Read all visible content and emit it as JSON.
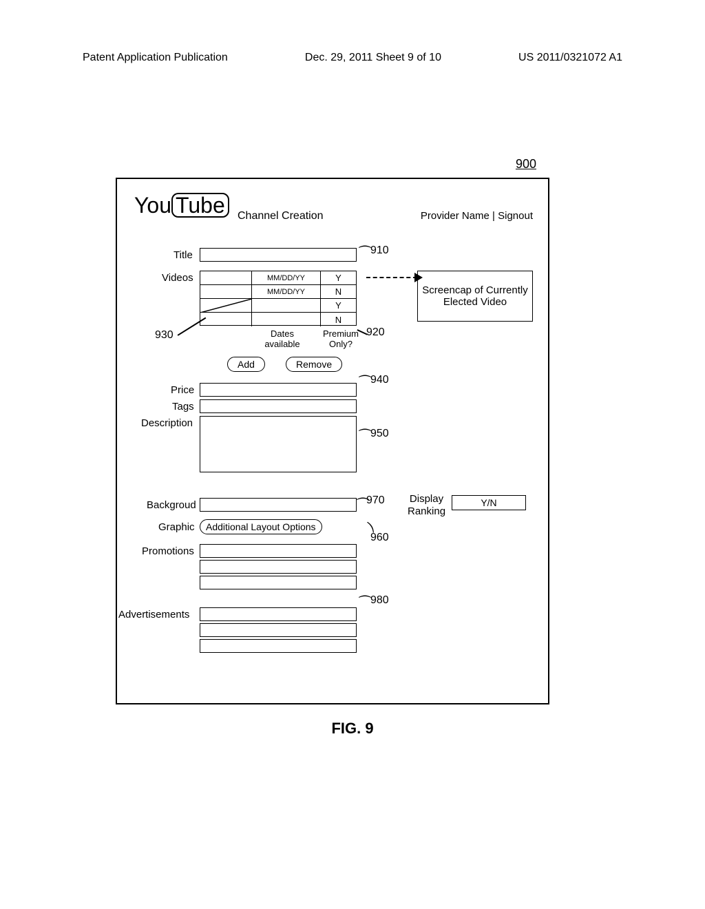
{
  "header": {
    "left": "Patent Application Publication",
    "center": "Dec. 29, 2011  Sheet 9 of 10",
    "right": "US 2011/0321072 A1"
  },
  "figure_ref": "900",
  "figure_caption": "FIG. 9",
  "logo": {
    "you": "You",
    "tube": "Tube"
  },
  "labels": {
    "channel_creation": "Channel Creation",
    "provider_signout": "Provider Name | Signout",
    "title": "Title",
    "videos": "Videos",
    "dates_available": "Dates available",
    "premium_only": "Premium Only?",
    "add": "Add",
    "remove": "Remove",
    "price": "Price",
    "tags": "Tags",
    "description": "Description",
    "background": "Backgroud",
    "graphic": "Graphic",
    "additional_layout": "Additional Layout Options",
    "promotions": "Promotions",
    "advertisements": "Advertisements",
    "screencap": "Screencap of Currently Elected Video",
    "display_ranking": "Display\nRanking",
    "ranking_value": "Y/N"
  },
  "videos_rows": [
    {
      "date": "MM/DD/YY",
      "premium": "Y",
      "slash": false
    },
    {
      "date": "MM/DD/YY",
      "premium": "N",
      "slash": false
    },
    {
      "date": "",
      "premium": "Y",
      "slash": true
    },
    {
      "date": "",
      "premium": "N",
      "slash": false
    }
  ],
  "callouts": {
    "c910": "910",
    "c920": "920",
    "c930": "930",
    "c940": "940",
    "c950": "950",
    "c960": "960",
    "c970": "970",
    "c980": "980"
  }
}
